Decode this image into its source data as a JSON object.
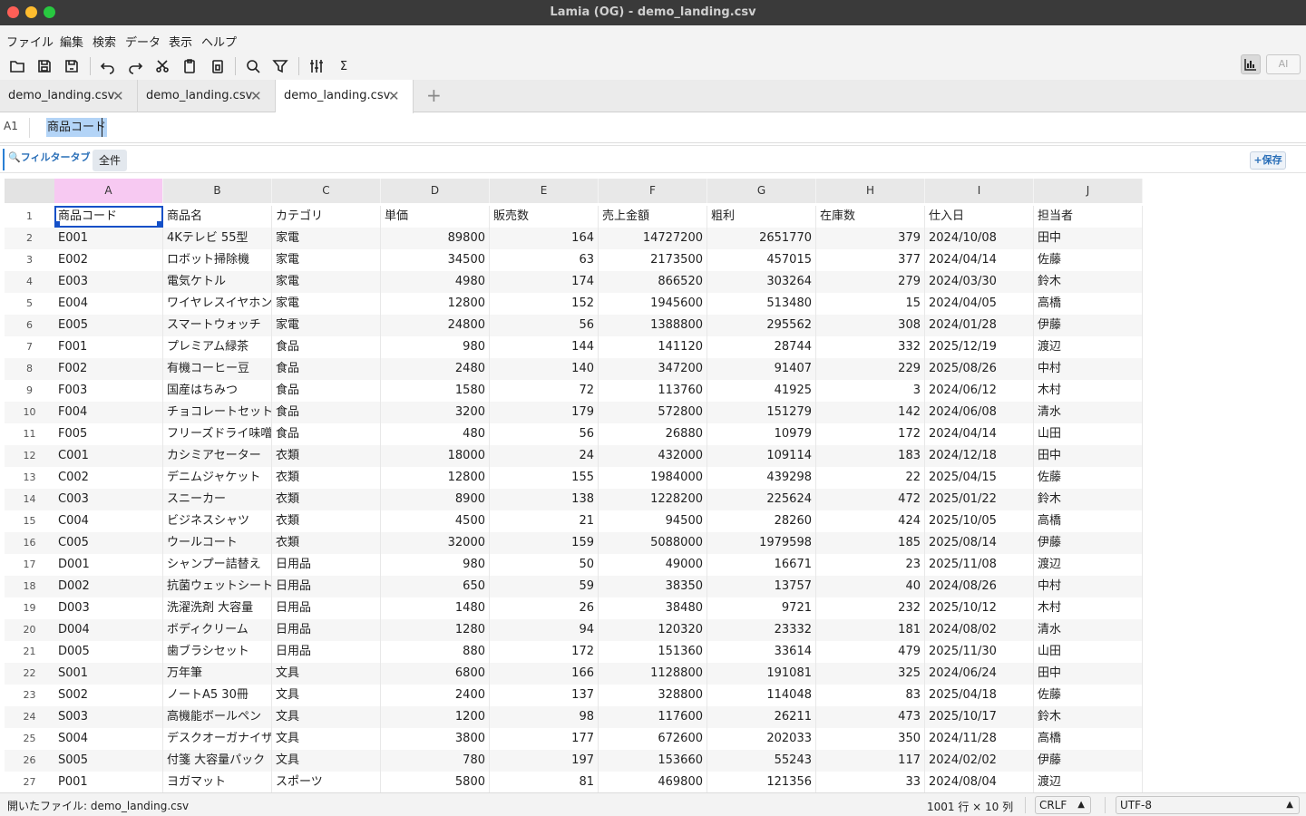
{
  "window": {
    "title": "Lamia (OG) - demo_landing.csv"
  },
  "menu": [
    "ファイル",
    "編集",
    "検索",
    "データ",
    "表示",
    "ヘルプ"
  ],
  "toolbar": {
    "icons": [
      "folder-open-icon",
      "save-icon",
      "save-as-icon",
      "undo-icon",
      "redo-icon",
      "cut-icon",
      "copy-icon",
      "paste-icon",
      "search-icon",
      "filter-icon",
      "sliders-icon",
      "sigma-icon"
    ],
    "sigma_label": "Σ",
    "ai_label": "AI"
  },
  "tabs": [
    {
      "label": "demo_landing.csv"
    },
    {
      "label": "demo_landing.csv"
    },
    {
      "label": "demo_landing.csv"
    }
  ],
  "new_tab_label": "+",
  "formula": {
    "cell_ref": "A1",
    "value": "商品コード"
  },
  "filter": {
    "tab_label": "🔍フィルタータブ",
    "all_label": "全件",
    "save_label": "+保存"
  },
  "columns": [
    "A",
    "B",
    "C",
    "D",
    "E",
    "F",
    "G",
    "H",
    "I",
    "J"
  ],
  "rows": [
    [
      "1",
      "商品コード",
      "商品名",
      "カテゴリ",
      "単価",
      "販売数",
      "売上金額",
      "粗利",
      "在庫数",
      "仕入日",
      "担当者"
    ],
    [
      "2",
      "E001",
      "4Kテレビ 55型",
      "家電",
      "89800",
      "164",
      "14727200",
      "2651770",
      "379",
      "2024/10/08",
      "田中"
    ],
    [
      "3",
      "E002",
      "ロボット掃除機",
      "家電",
      "34500",
      "63",
      "2173500",
      "457015",
      "377",
      "2024/04/14",
      "佐藤"
    ],
    [
      "4",
      "E003",
      "電気ケトル",
      "家電",
      "4980",
      "174",
      "866520",
      "303264",
      "279",
      "2024/03/30",
      "鈴木"
    ],
    [
      "5",
      "E004",
      "ワイヤレスイヤホン",
      "家電",
      "12800",
      "152",
      "1945600",
      "513480",
      "15",
      "2024/04/05",
      "高橋"
    ],
    [
      "6",
      "E005",
      "スマートウォッチ",
      "家電",
      "24800",
      "56",
      "1388800",
      "295562",
      "308",
      "2024/01/28",
      "伊藤"
    ],
    [
      "7",
      "F001",
      "プレミアム緑茶",
      "食品",
      "980",
      "144",
      "141120",
      "28744",
      "332",
      "2025/12/19",
      "渡辺"
    ],
    [
      "8",
      "F002",
      "有機コーヒー豆",
      "食品",
      "2480",
      "140",
      "347200",
      "91407",
      "229",
      "2025/08/26",
      "中村"
    ],
    [
      "9",
      "F003",
      "国産はちみつ",
      "食品",
      "1580",
      "72",
      "113760",
      "41925",
      "3",
      "2024/06/12",
      "木村"
    ],
    [
      "10",
      "F004",
      "チョコレートセット",
      "食品",
      "3200",
      "179",
      "572800",
      "151279",
      "142",
      "2024/06/08",
      "清水"
    ],
    [
      "11",
      "F005",
      "フリーズドライ味噌汁",
      "食品",
      "480",
      "56",
      "26880",
      "10979",
      "172",
      "2024/04/14",
      "山田"
    ],
    [
      "12",
      "C001",
      "カシミアセーター",
      "衣類",
      "18000",
      "24",
      "432000",
      "109114",
      "183",
      "2024/12/18",
      "田中"
    ],
    [
      "13",
      "C002",
      "デニムジャケット",
      "衣類",
      "12800",
      "155",
      "1984000",
      "439298",
      "22",
      "2025/04/15",
      "佐藤"
    ],
    [
      "14",
      "C003",
      "スニーカー",
      "衣類",
      "8900",
      "138",
      "1228200",
      "225624",
      "472",
      "2025/01/22",
      "鈴木"
    ],
    [
      "15",
      "C004",
      "ビジネスシャツ",
      "衣類",
      "4500",
      "21",
      "94500",
      "28260",
      "424",
      "2025/10/05",
      "高橋"
    ],
    [
      "16",
      "C005",
      "ウールコート",
      "衣類",
      "32000",
      "159",
      "5088000",
      "1979598",
      "185",
      "2025/08/14",
      "伊藤"
    ],
    [
      "17",
      "D001",
      "シャンプー詰替え",
      "日用品",
      "980",
      "50",
      "49000",
      "16671",
      "23",
      "2025/11/08",
      "渡辺"
    ],
    [
      "18",
      "D002",
      "抗菌ウェットシート",
      "日用品",
      "650",
      "59",
      "38350",
      "13757",
      "40",
      "2024/08/26",
      "中村"
    ],
    [
      "19",
      "D003",
      "洗濯洗剤 大容量",
      "日用品",
      "1480",
      "26",
      "38480",
      "9721",
      "232",
      "2025/10/12",
      "木村"
    ],
    [
      "20",
      "D004",
      "ボディクリーム",
      "日用品",
      "1280",
      "94",
      "120320",
      "23332",
      "181",
      "2024/08/02",
      "清水"
    ],
    [
      "21",
      "D005",
      "歯ブラシセット",
      "日用品",
      "880",
      "172",
      "151360",
      "33614",
      "479",
      "2025/11/30",
      "山田"
    ],
    [
      "22",
      "S001",
      "万年筆",
      "文具",
      "6800",
      "166",
      "1128800",
      "191081",
      "325",
      "2024/06/24",
      "田中"
    ],
    [
      "23",
      "S002",
      "ノートA5 30冊",
      "文具",
      "2400",
      "137",
      "328800",
      "114048",
      "83",
      "2025/04/18",
      "佐藤"
    ],
    [
      "24",
      "S003",
      "高機能ボールペン",
      "文具",
      "1200",
      "98",
      "117600",
      "26211",
      "473",
      "2025/10/17",
      "鈴木"
    ],
    [
      "25",
      "S004",
      "デスクオーガナイザー",
      "文具",
      "3800",
      "177",
      "672600",
      "202033",
      "350",
      "2024/11/28",
      "高橋"
    ],
    [
      "26",
      "S005",
      "付箋 大容量パック",
      "文具",
      "780",
      "197",
      "153660",
      "55243",
      "117",
      "2024/02/02",
      "伊藤"
    ],
    [
      "27",
      "P001",
      "ヨガマット",
      "スポーツ",
      "5800",
      "81",
      "469800",
      "121356",
      "33",
      "2024/08/04",
      "渡辺"
    ]
  ],
  "status": {
    "file": "開いたファイル: demo_landing.csv",
    "size": "1001 行 × 10 列",
    "line_ending": "CRLF",
    "encoding": "UTF-8"
  }
}
